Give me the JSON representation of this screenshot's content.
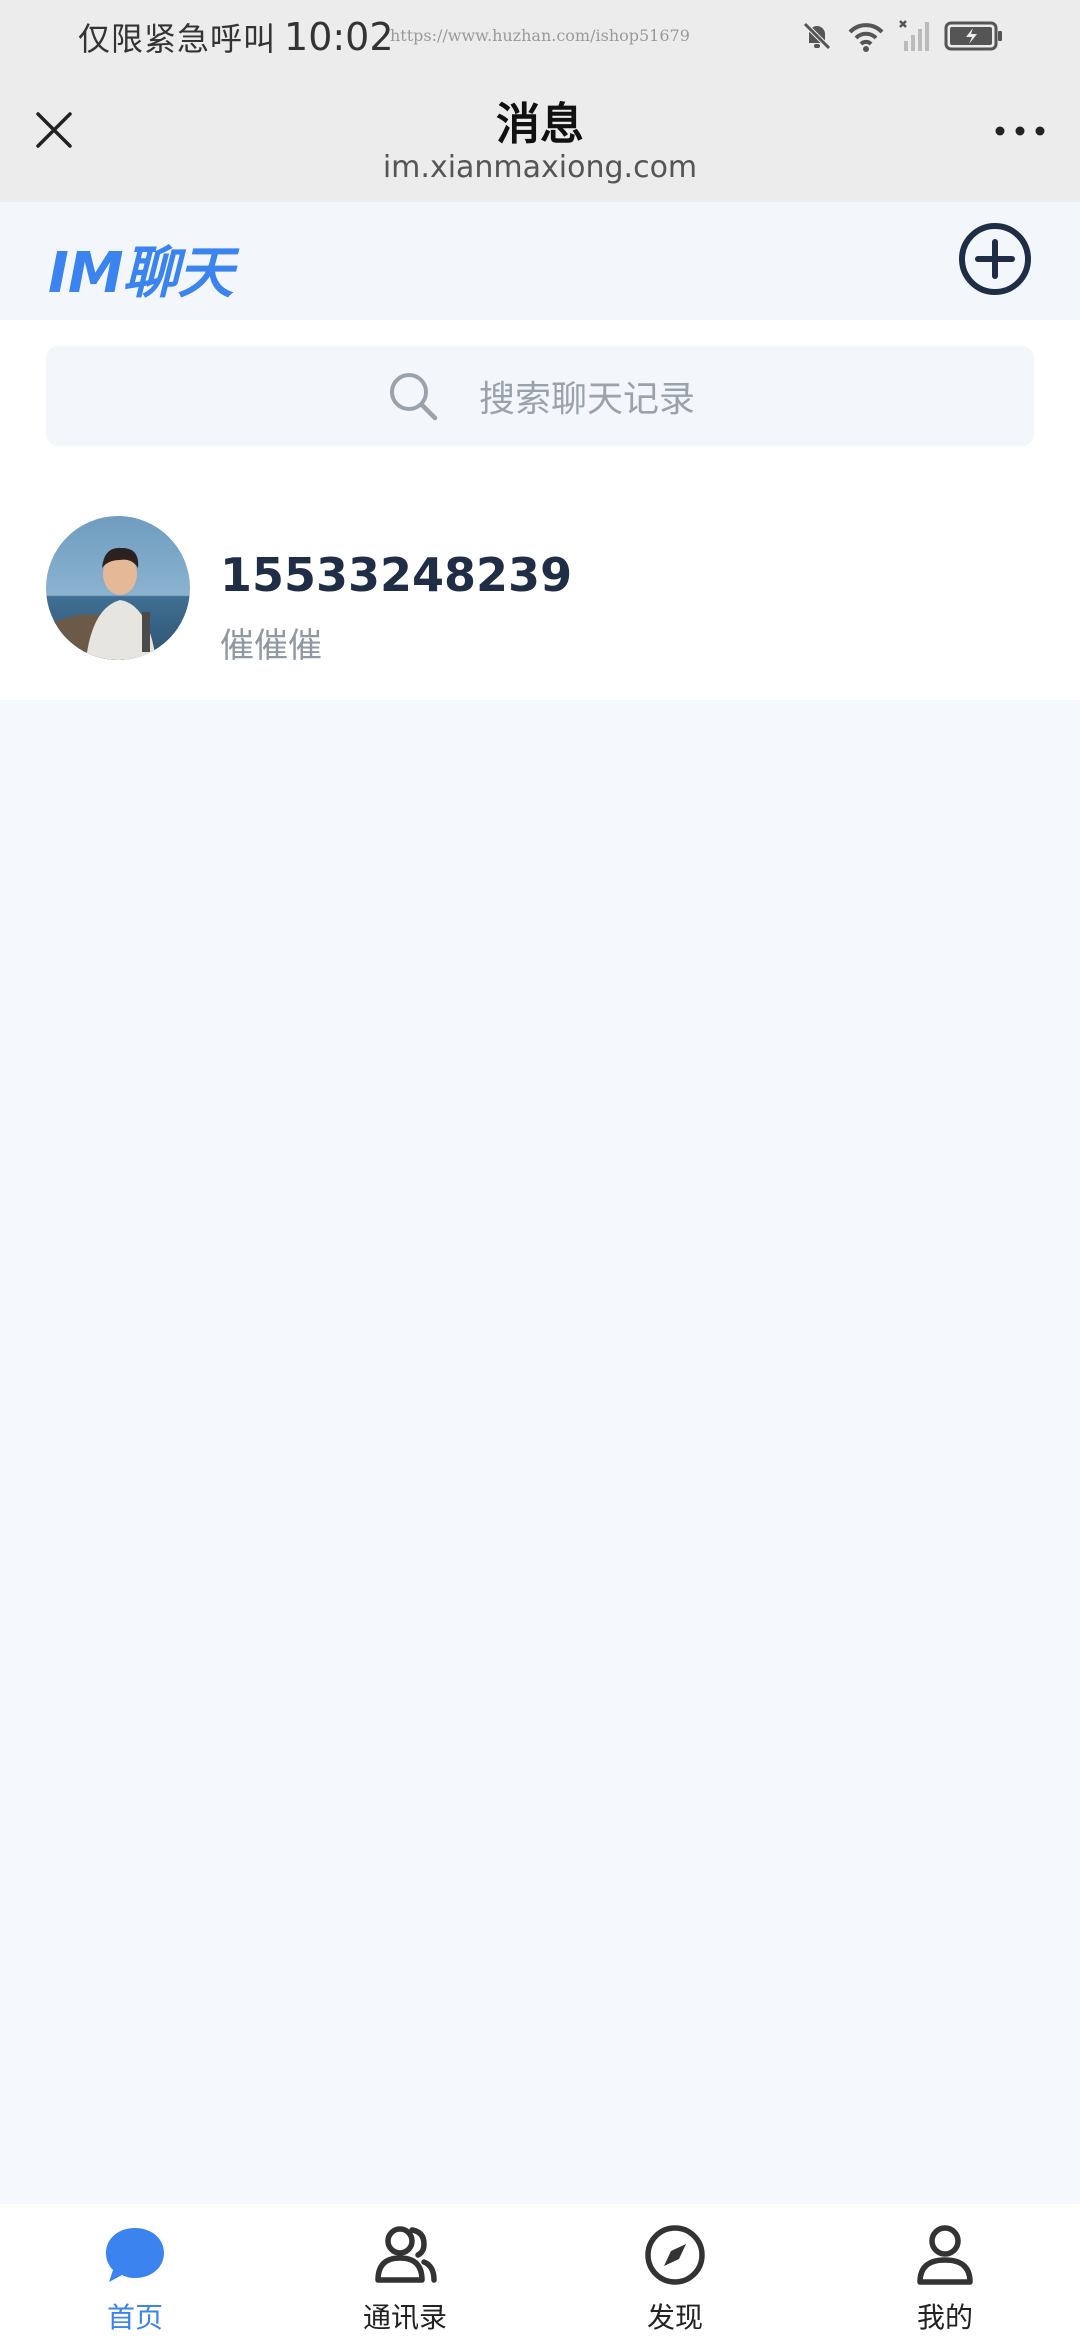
{
  "status_bar": {
    "emergency_text": "仅限紧急呼叫",
    "time": "10:02",
    "watermark_url": "https://www.huzhan.com/ishop51679",
    "icons": [
      "mute-bell-icon",
      "wifi-icon",
      "signal-icon",
      "battery-icon"
    ]
  },
  "header": {
    "title": "消息",
    "subtitle": "im.xianmaxiong.com",
    "close_icon": "close-icon",
    "more_icon": "more-icon"
  },
  "app_bar": {
    "logo_text": "IM聊天",
    "add_icon": "add-circle-icon",
    "accent_color": "#3b84f0"
  },
  "search": {
    "placeholder": "搜索聊天记录"
  },
  "chats": [
    {
      "name": "15533248239",
      "preview": "催催催"
    }
  ],
  "bottom_nav": {
    "items": [
      {
        "label": "首页",
        "icon": "chat-bubble-icon",
        "active": true
      },
      {
        "label": "通讯录",
        "icon": "contacts-icon",
        "active": false
      },
      {
        "label": "发现",
        "icon": "compass-icon",
        "active": false
      },
      {
        "label": "我的",
        "icon": "user-icon",
        "active": false
      }
    ]
  }
}
